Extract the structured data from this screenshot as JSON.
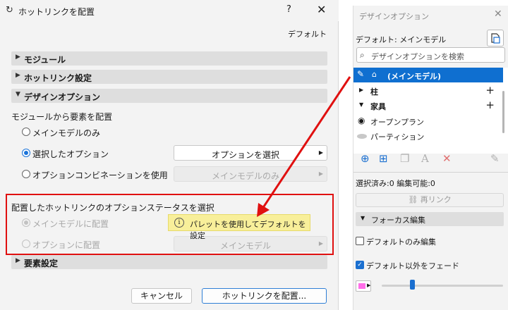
{
  "dialog": {
    "title": "ホットリンクを配置",
    "help": "?",
    "close": "✕",
    "default_label": "デフォルト",
    "sections": {
      "module": "モジュール",
      "hotlink_settings": "ホットリンク設定",
      "design_option": "デザインオプション",
      "element_settings": "要素設定"
    },
    "place_from_module": "モジュールから要素を配置",
    "radio_main_only": "メインモデルのみ",
    "radio_selected_option": "選択したオプション",
    "radio_combination": "オプションコンビネーションを使用",
    "select_option_button": "オプションを選択",
    "combination_value": "メインモデルのみ",
    "status_heading": "配置したホットリンクのオプションステータスを選択",
    "radio_place_main": "メインモデルに配置",
    "radio_place_option": "オプションに配置",
    "option_place_value": "メインモデル",
    "tooltip": "パレットを使用してデフォルトを設定",
    "cancel_button": "キャンセル",
    "place_button": "ホットリンクを配置..."
  },
  "palette": {
    "title": "デザインオプション",
    "close": "✕",
    "default_line": "デフォルト: メインモデル",
    "search_placeholder": "デザインオプションを検索",
    "selected_row": "(メインモデル)",
    "groups": [
      {
        "label": "柱",
        "expanded": false
      },
      {
        "label": "家具",
        "expanded": true
      }
    ],
    "items": [
      "オープンプラン",
      "パーティション"
    ],
    "status_line": "選択済み:0 編集可能:0",
    "relink_button": "再リンク",
    "focus_edit": "フォーカス編集",
    "cb_default_only": "デフォルトのみ編集",
    "cb_fade_others": "デフォルト以外をフェード",
    "colors": {
      "accent": "#0f6fd0",
      "highlight_box": "#e01010",
      "tooltip_bg": "#f8ef9a",
      "fade_swatch": "#ff6ee8"
    }
  }
}
